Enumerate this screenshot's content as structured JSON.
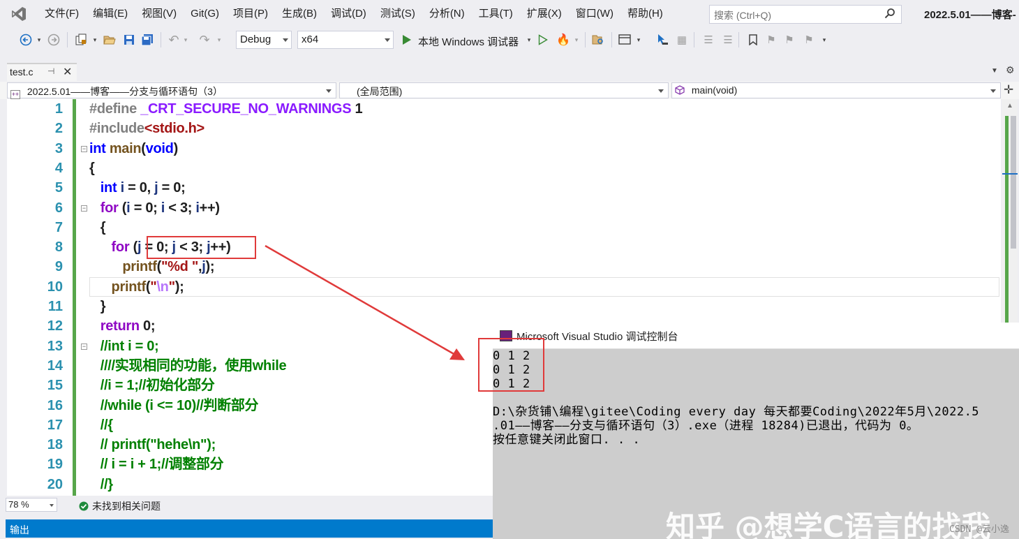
{
  "menu": {
    "items": [
      "文件(F)",
      "编辑(E)",
      "视图(V)",
      "Git(G)",
      "项目(P)",
      "生成(B)",
      "调试(D)",
      "测试(S)",
      "分析(N)",
      "工具(T)",
      "扩展(X)",
      "窗口(W)",
      "帮助(H)"
    ],
    "search_placeholder": "搜索 (Ctrl+Q)",
    "window_title": "2022.5.01——博客-"
  },
  "toolbar": {
    "configuration": "Debug",
    "platform": "x64",
    "run_label": "本地 Windows 调试器"
  },
  "tab": {
    "filename": "test.c"
  },
  "navbar": {
    "project": "2022.5.01——博客——分支与循环语句（3）",
    "scope": "(全局范围)",
    "member": "main(void)"
  },
  "editor": {
    "line_numbers": [
      "1",
      "2",
      "3",
      "4",
      "5",
      "6",
      "7",
      "8",
      "9",
      "10",
      "11",
      "12",
      "13",
      "14",
      "15",
      "16",
      "17",
      "18",
      "19",
      "20"
    ]
  },
  "status": {
    "zoom": "78 %",
    "issues": "未找到相关问题"
  },
  "output_pane": {
    "title": "输出"
  },
  "console": {
    "title": "Microsoft Visual Studio 调试控制台",
    "lines": [
      "0 1 2",
      "0 1 2",
      "0 1 2",
      "",
      "D:\\杂货铺\\编程\\gitee\\Coding every day 每天都要Coding\\2022年5月\\2022.5",
      ".01——博客——分支与循环语句（3）.exe（进程 18284)已退出，代码为 0。",
      "按任意键关闭此窗口. . ."
    ]
  },
  "watermark": "知乎 @想学C语言的找我",
  "csdn_credit": "CSDN @云小逸",
  "colors": {
    "accent": "#007acc",
    "highlight_box": "#e03a3a",
    "line_number": "#2b91af",
    "keyword": "#0000ff",
    "comment": "#008000"
  }
}
